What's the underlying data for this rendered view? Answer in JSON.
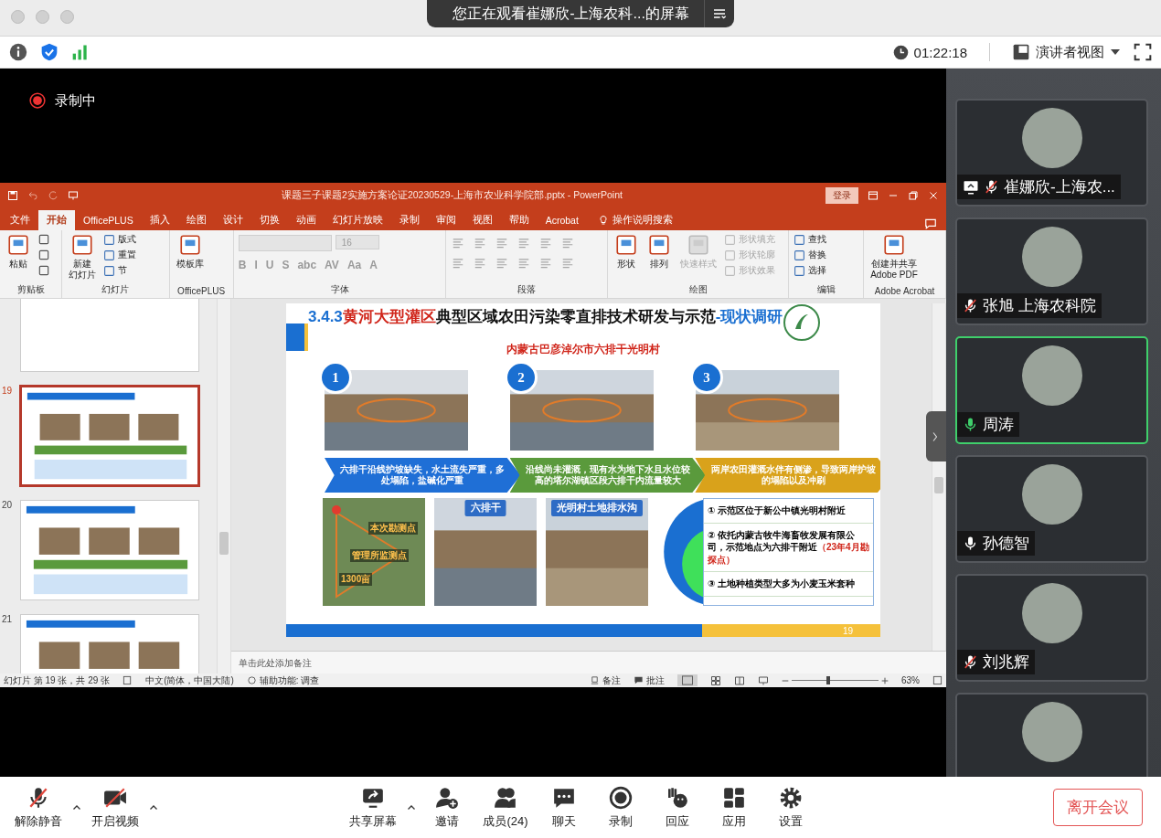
{
  "top_bar": {
    "banner": "您正在观看崔娜欣-上海农科...的屏幕"
  },
  "info_bar": {
    "time": "01:22:18",
    "view_label": "演讲者视图"
  },
  "recording": {
    "label": "录制中"
  },
  "powerpoint": {
    "title": "课题三子课题2实施方案论证20230529-上海市农业科学院部.pptx  -  PowerPoint",
    "login": "登录",
    "tabs": [
      {
        "label": "文件",
        "selected": false
      },
      {
        "label": "开始",
        "selected": true
      },
      {
        "label": "OfficePLUS",
        "selected": false
      },
      {
        "label": "插入",
        "selected": false
      },
      {
        "label": "绘图",
        "selected": false
      },
      {
        "label": "设计",
        "selected": false
      },
      {
        "label": "切换",
        "selected": false
      },
      {
        "label": "动画",
        "selected": false
      },
      {
        "label": "幻灯片放映",
        "selected": false
      },
      {
        "label": "录制",
        "selected": false
      },
      {
        "label": "审阅",
        "selected": false
      },
      {
        "label": "视图",
        "selected": false
      },
      {
        "label": "帮助",
        "selected": false
      },
      {
        "label": "Acrobat",
        "selected": false
      }
    ],
    "search_hint": "操作说明搜索",
    "ribbon_groups": [
      {
        "label": "剪贴板",
        "kind": "buttons",
        "large_buttons": [
          {
            "lines": [
              "粘贴"
            ],
            "disabled": false
          }
        ]
      },
      {
        "label": "幻灯片",
        "kind": "buttons",
        "large_buttons": [
          {
            "lines": [
              "新建",
              "幻灯片"
            ],
            "disabled": false
          }
        ],
        "small_buttons": [
          {
            "label": "版式",
            "disabled": false
          },
          {
            "label": "重置",
            "disabled": false
          },
          {
            "label": "节",
            "disabled": false
          }
        ]
      },
      {
        "label": "OfficePLUS",
        "kind": "buttons",
        "large_buttons": [
          {
            "lines": [
              "模板库"
            ],
            "disabled": false
          }
        ]
      },
      {
        "label": "字体",
        "kind": "font",
        "font_size": "16",
        "glyphs": [
          "B",
          "I",
          "U",
          "S",
          "abc",
          "AV",
          "Aa",
          "A"
        ]
      },
      {
        "label": "段落",
        "kind": "paragraph"
      },
      {
        "label": "绘图",
        "kind": "buttons",
        "large_buttons": [
          {
            "lines": [
              "形状"
            ],
            "disabled": false
          },
          {
            "lines": [
              "排列"
            ],
            "disabled": false
          },
          {
            "lines": [
              "快速样式"
            ],
            "disabled": true
          }
        ],
        "small_buttons": [
          {
            "label": "形状填充",
            "disabled": true
          },
          {
            "label": "形状轮廓",
            "disabled": true
          },
          {
            "label": "形状效果",
            "disabled": true
          }
        ]
      },
      {
        "label": "编辑",
        "kind": "buttons",
        "small_buttons": [
          {
            "label": "查找",
            "disabled": false
          },
          {
            "label": "替换",
            "disabled": false
          },
          {
            "label": "选择",
            "disabled": false
          }
        ]
      },
      {
        "label": "Adobe Acrobat",
        "kind": "buttons",
        "large_buttons": [
          {
            "lines": [
              "创建并共享",
              "Adobe PDF"
            ],
            "disabled": false
          }
        ]
      }
    ],
    "thumbnails": [
      {
        "number": "19",
        "selected": true
      },
      {
        "number": "20",
        "selected": false
      },
      {
        "number": "21",
        "selected": false
      }
    ],
    "slide": {
      "title_parts": [
        {
          "text": "3.4.3",
          "kind": "number"
        },
        {
          "text": "黄河大型灌区",
          "kind": "highlight"
        },
        {
          "text": "典型区域农田污染零直排技术研发与示范",
          "kind": "plain"
        },
        {
          "text": "-现状调研",
          "kind": "accent"
        }
      ],
      "subtitle": "内蒙古巴彦淖尔市六排干光明村",
      "photos": [
        {
          "badge": "1"
        },
        {
          "badge": "2"
        },
        {
          "badge": "3"
        }
      ],
      "arrows": [
        {
          "text": "六排干沿线护坡缺失，水土流失严重，多处塌陷，盐碱化严重",
          "color": "#1f6fd6"
        },
        {
          "text": "沿线尚未灌溉，现有水为地下水且水位较高的塔尔湖镇区段六排干内流量较大",
          "color": "#5a9a3c"
        },
        {
          "text": "两岸农田灌溉水伴有侧渗，导致两岸护坡的塌陷以及冲刷",
          "color": "#d9a21b"
        }
      ],
      "map_labels": [
        "本次勘测点",
        "管理所监测点",
        "1300亩"
      ],
      "captioned_photos": [
        {
          "caption": "六排干"
        },
        {
          "caption": "光明村土地排水沟"
        }
      ],
      "facts": [
        {
          "text": "① 示范区位于新公中镇光明村附近"
        },
        {
          "text": "② 依托内蒙古牧牛海畜牧发展有限公司，示范地点为六排干附近",
          "note": "（23年4月勘探点）"
        },
        {
          "text": "③ 土地种植类型大多为小麦玉米套种"
        }
      ],
      "page_number": "19"
    },
    "notes_placeholder": "单击此处添加备注",
    "status_bar": {
      "slide_info": "幻灯片 第 19 张，共 29 张",
      "language": "中文(简体，中国大陆)",
      "accessibility": "辅助功能: 调查",
      "notes": "备注",
      "comments": "批注",
      "zoom": "63%",
      "zoom_slider": {
        "level": 0.42
      }
    }
  },
  "participants": [
    {
      "kind": "full",
      "name": "崔娜欣-上海农...",
      "muted": true,
      "sharing": true,
      "speaking": false
    },
    {
      "kind": "full",
      "name": "张旭 上海农科院",
      "muted": true,
      "sharing": false,
      "speaking": false
    },
    {
      "kind": "full",
      "name": "周涛",
      "muted": false,
      "sharing": false,
      "speaking": true
    },
    {
      "kind": "full",
      "name": "孙德智",
      "muted": false,
      "sharing": false,
      "speaking": false
    },
    {
      "kind": "full",
      "name": "刘兆辉",
      "muted": true,
      "sharing": false,
      "speaking": false
    },
    {
      "kind": "cut"
    }
  ],
  "toolbar": {
    "left": [
      {
        "label": "解除静音",
        "kind": "mic"
      },
      {
        "label": "开启视频",
        "kind": "video"
      }
    ],
    "center": [
      {
        "label": "共享屏幕",
        "kind": "share"
      },
      {
        "label": "邀请",
        "kind": "invite"
      },
      {
        "label": "成员(24)",
        "kind": "members"
      },
      {
        "label": "聊天",
        "kind": "chat"
      },
      {
        "label": "录制",
        "kind": "record"
      },
      {
        "label": "回应",
        "kind": "react"
      },
      {
        "label": "应用",
        "kind": "apps"
      },
      {
        "label": "设置",
        "kind": "settings"
      }
    ],
    "leave": "离开会议"
  }
}
